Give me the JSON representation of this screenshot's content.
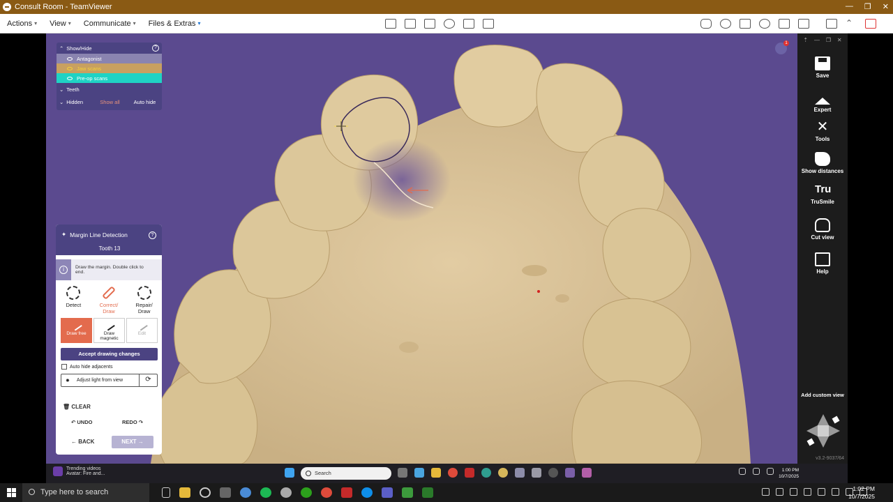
{
  "window": {
    "title": "Consult Room - TeamViewer"
  },
  "menu": {
    "items": [
      {
        "label": "Actions"
      },
      {
        "label": "View"
      },
      {
        "label": "Communicate"
      },
      {
        "label": "Files & Extras"
      }
    ]
  },
  "showhide_panel": {
    "title": "Show/Hide",
    "layers": [
      {
        "label": "Antagonist",
        "color": "#8a84b0",
        "text_color": "#ffffff"
      },
      {
        "label": "Jaw scans",
        "color": "#c8a060",
        "text_color": "#f4d13a"
      },
      {
        "label": "Pre-op scans",
        "color": "#1fd3c4",
        "text_color": "#ffffff"
      }
    ],
    "teeth_label": "Teeth",
    "hidden_label": "Hidden",
    "show_all_label": "Show all",
    "auto_hide_label": "Auto hide"
  },
  "margin_panel": {
    "title": "Margin Line Detection",
    "subtitle": "Tooth 13",
    "info_text": "Draw the margin. Double click to end.",
    "modes": [
      {
        "label_line1": "Detect",
        "label_line2": ""
      },
      {
        "label_line1": "Correct/",
        "label_line2": "Draw"
      },
      {
        "label_line1": "Repair/",
        "label_line2": "Draw"
      }
    ],
    "draw_buttons": [
      {
        "label_line1": "Draw free",
        "label_line2": ""
      },
      {
        "label_line1": "Draw",
        "label_line2": "magnetic"
      },
      {
        "label_line1": "Edit",
        "label_line2": ""
      }
    ],
    "accept_label": "Accept drawing changes",
    "auto_hide_label": "Auto hide adjacents",
    "adjust_light_label": "Adjust light from view",
    "clear_label": "CLEAR",
    "undo_label": "UNDO",
    "redo_label": "REDO",
    "back_label": "BACK",
    "next_label": "NEXT"
  },
  "right_sidebar": {
    "tools": [
      {
        "label": "Save",
        "icon": "save-icon"
      },
      {
        "label": "Expert",
        "icon": "graduation-cap-icon"
      },
      {
        "label": "Tools",
        "icon": "tools-icon"
      },
      {
        "label": "Show distances",
        "icon": "distance-icon"
      },
      {
        "label": "TruSmile",
        "icon": "trusmile-icon",
        "icon_text": "Tru"
      },
      {
        "label": "Cut view",
        "icon": "cut-view-icon"
      },
      {
        "label": "Help",
        "icon": "help-book-icon"
      }
    ],
    "add_custom_view_label": "Add custom view",
    "version": "v3.2-9037/64"
  },
  "notification": {
    "count": "1"
  },
  "remote_taskbar": {
    "trending_title": "Trending videos",
    "trending_sub": "Avatar: Fire and...",
    "search_placeholder": "Search",
    "clock_time": "1:00 PM",
    "clock_date": "10/7/2025"
  },
  "local_taskbar": {
    "search_placeholder": "Type here to search",
    "clock_time": "1:02 PM",
    "clock_date": "10/7/2025"
  },
  "colors": {
    "viewport_bg": "#5b4a8f",
    "teeth": "#dcc59a",
    "accent": "#e36b4d",
    "panel": "#4b4382"
  }
}
